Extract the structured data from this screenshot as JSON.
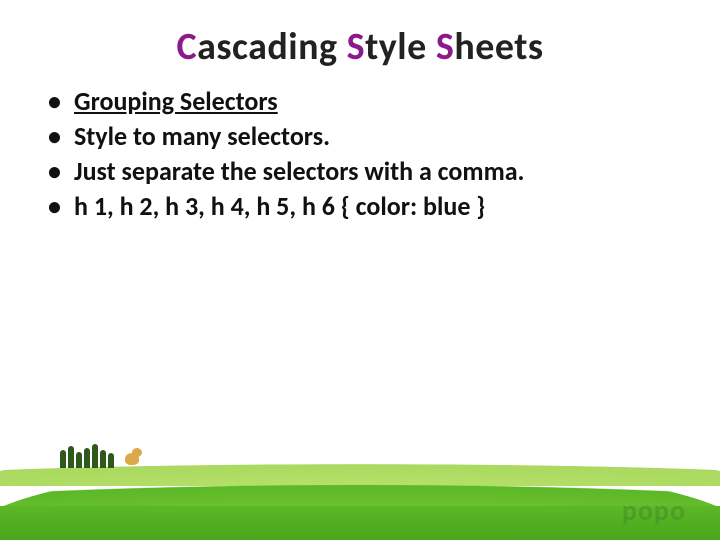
{
  "title": {
    "letters": [
      "C",
      "ascading ",
      "S",
      "tyle ",
      "S",
      "heets"
    ]
  },
  "bullets": [
    {
      "text": "Grouping Selectors",
      "underlined": true
    },
    {
      "text": "Style to many selectors.",
      "underlined": false
    },
    {
      "text": "Just separate the selectors with a comma.",
      "underlined": false
    },
    {
      "text": "h 1, h 2, h 3, h 4, h 5, h 6 { color: blue }",
      "underlined": false
    }
  ],
  "watermark": "popo"
}
